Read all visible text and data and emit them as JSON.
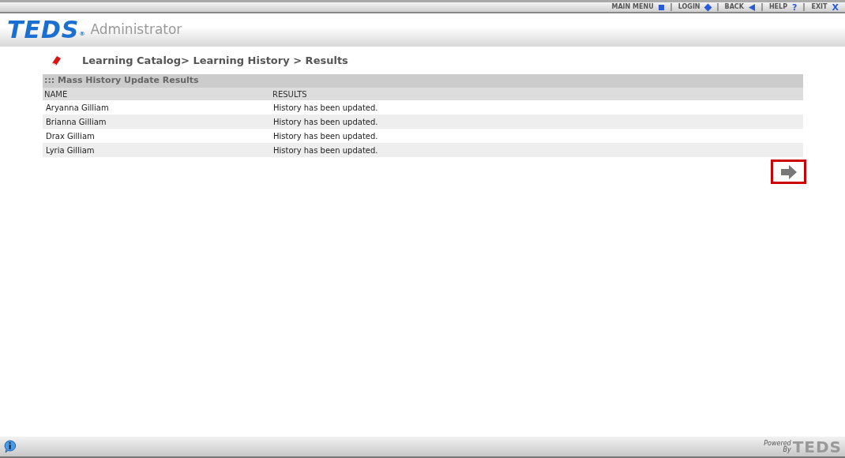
{
  "top_nav": [
    {
      "label": "MAIN MENU",
      "kind": "square"
    },
    {
      "label": "LOGIN",
      "kind": "diamond"
    },
    {
      "label": "BACK",
      "kind": "left"
    },
    {
      "label": "HELP",
      "kind": "glyph",
      "glyph": "?"
    },
    {
      "label": "EXIT",
      "kind": "glyph",
      "glyph": "X"
    }
  ],
  "logo": {
    "text": "TEDS",
    "mark": "®",
    "subtitle": "Administrator"
  },
  "breadcrumb": "Learning Catalog> Learning History > Results",
  "panel_title": "::: Mass History Update Results",
  "table": {
    "columns": [
      "NAME",
      "RESULTS"
    ],
    "rows": [
      [
        "Aryanna Gilliam",
        "History has been updated."
      ],
      [
        "Brianna Gilliam",
        "History has been updated."
      ],
      [
        "Drax Gilliam",
        "History has been updated."
      ],
      [
        "Lyria Gilliam",
        "History has been updated."
      ]
    ]
  },
  "next_button": {
    "highlighted": true
  },
  "footer": {
    "powered": "Powered",
    "by": "By",
    "brand": "TEDS"
  }
}
